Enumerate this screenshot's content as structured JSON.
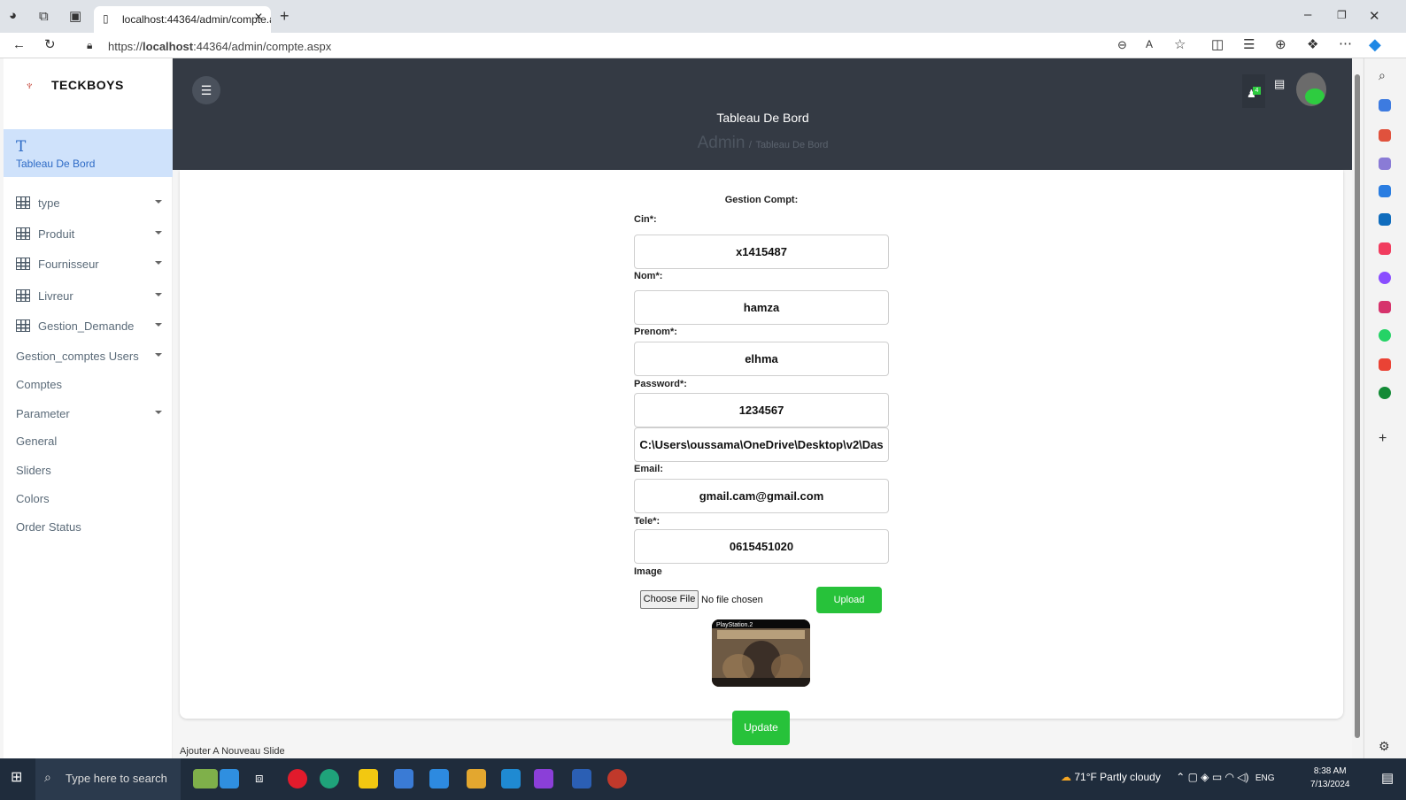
{
  "browser": {
    "tab_title": "localhost:44364/admin/compte.a",
    "url_prefix": "https://",
    "url_host": "localhost",
    "url_rest": ":44364/admin/compte.aspx"
  },
  "sidebar": {
    "brand": "TECKBOYS",
    "active_letter": "T",
    "active_label": "Tableau De Bord",
    "items": [
      {
        "label": "type"
      },
      {
        "label": "Produit"
      },
      {
        "label": "Fournisseur"
      },
      {
        "label": "Livreur"
      },
      {
        "label": "Gestion_Demande"
      },
      {
        "label": "Gestion_comptes Users"
      },
      {
        "label": "Comptes"
      },
      {
        "label": "Parameter"
      },
      {
        "label": "General"
      },
      {
        "label": "Sliders"
      },
      {
        "label": "Colors"
      },
      {
        "label": "Order Status"
      }
    ]
  },
  "header": {
    "title": "Tableau De Bord",
    "crumb_root": "Admin",
    "crumb_sep": "/",
    "crumb_current": "Tableau De Bord",
    "notif_count": "4"
  },
  "form": {
    "title": "Gestion Compt:",
    "cin_label": "Cin*:",
    "cin_value": "x1415487",
    "nom_label": "Nom*:",
    "nom_value": "hamza",
    "prenom_label": "Prenom*:",
    "prenom_value": "elhma",
    "password_label": "Password*:",
    "password_value": "1234567",
    "path_value": "C:\\Users\\oussama\\OneDrive\\Desktop\\v2\\Das",
    "email_label": "Email:",
    "email_value": "gmail.cam@gmail.com",
    "tele_label": "Tele*:",
    "tele_value": "0615451020",
    "image_label": "Image",
    "choose_file": "Choose File",
    "no_file": "No file chosen",
    "upload": "Upload",
    "preview_caption": "PlayStation.2",
    "update": "Update"
  },
  "footer_text": "Ajouter A Nouveau Slide",
  "taskbar": {
    "search_placeholder": "Type here to search",
    "weather": "71°F  Partly cloudy",
    "lang": "ENG",
    "time": "8:38 AM",
    "date": "7/13/2024"
  }
}
